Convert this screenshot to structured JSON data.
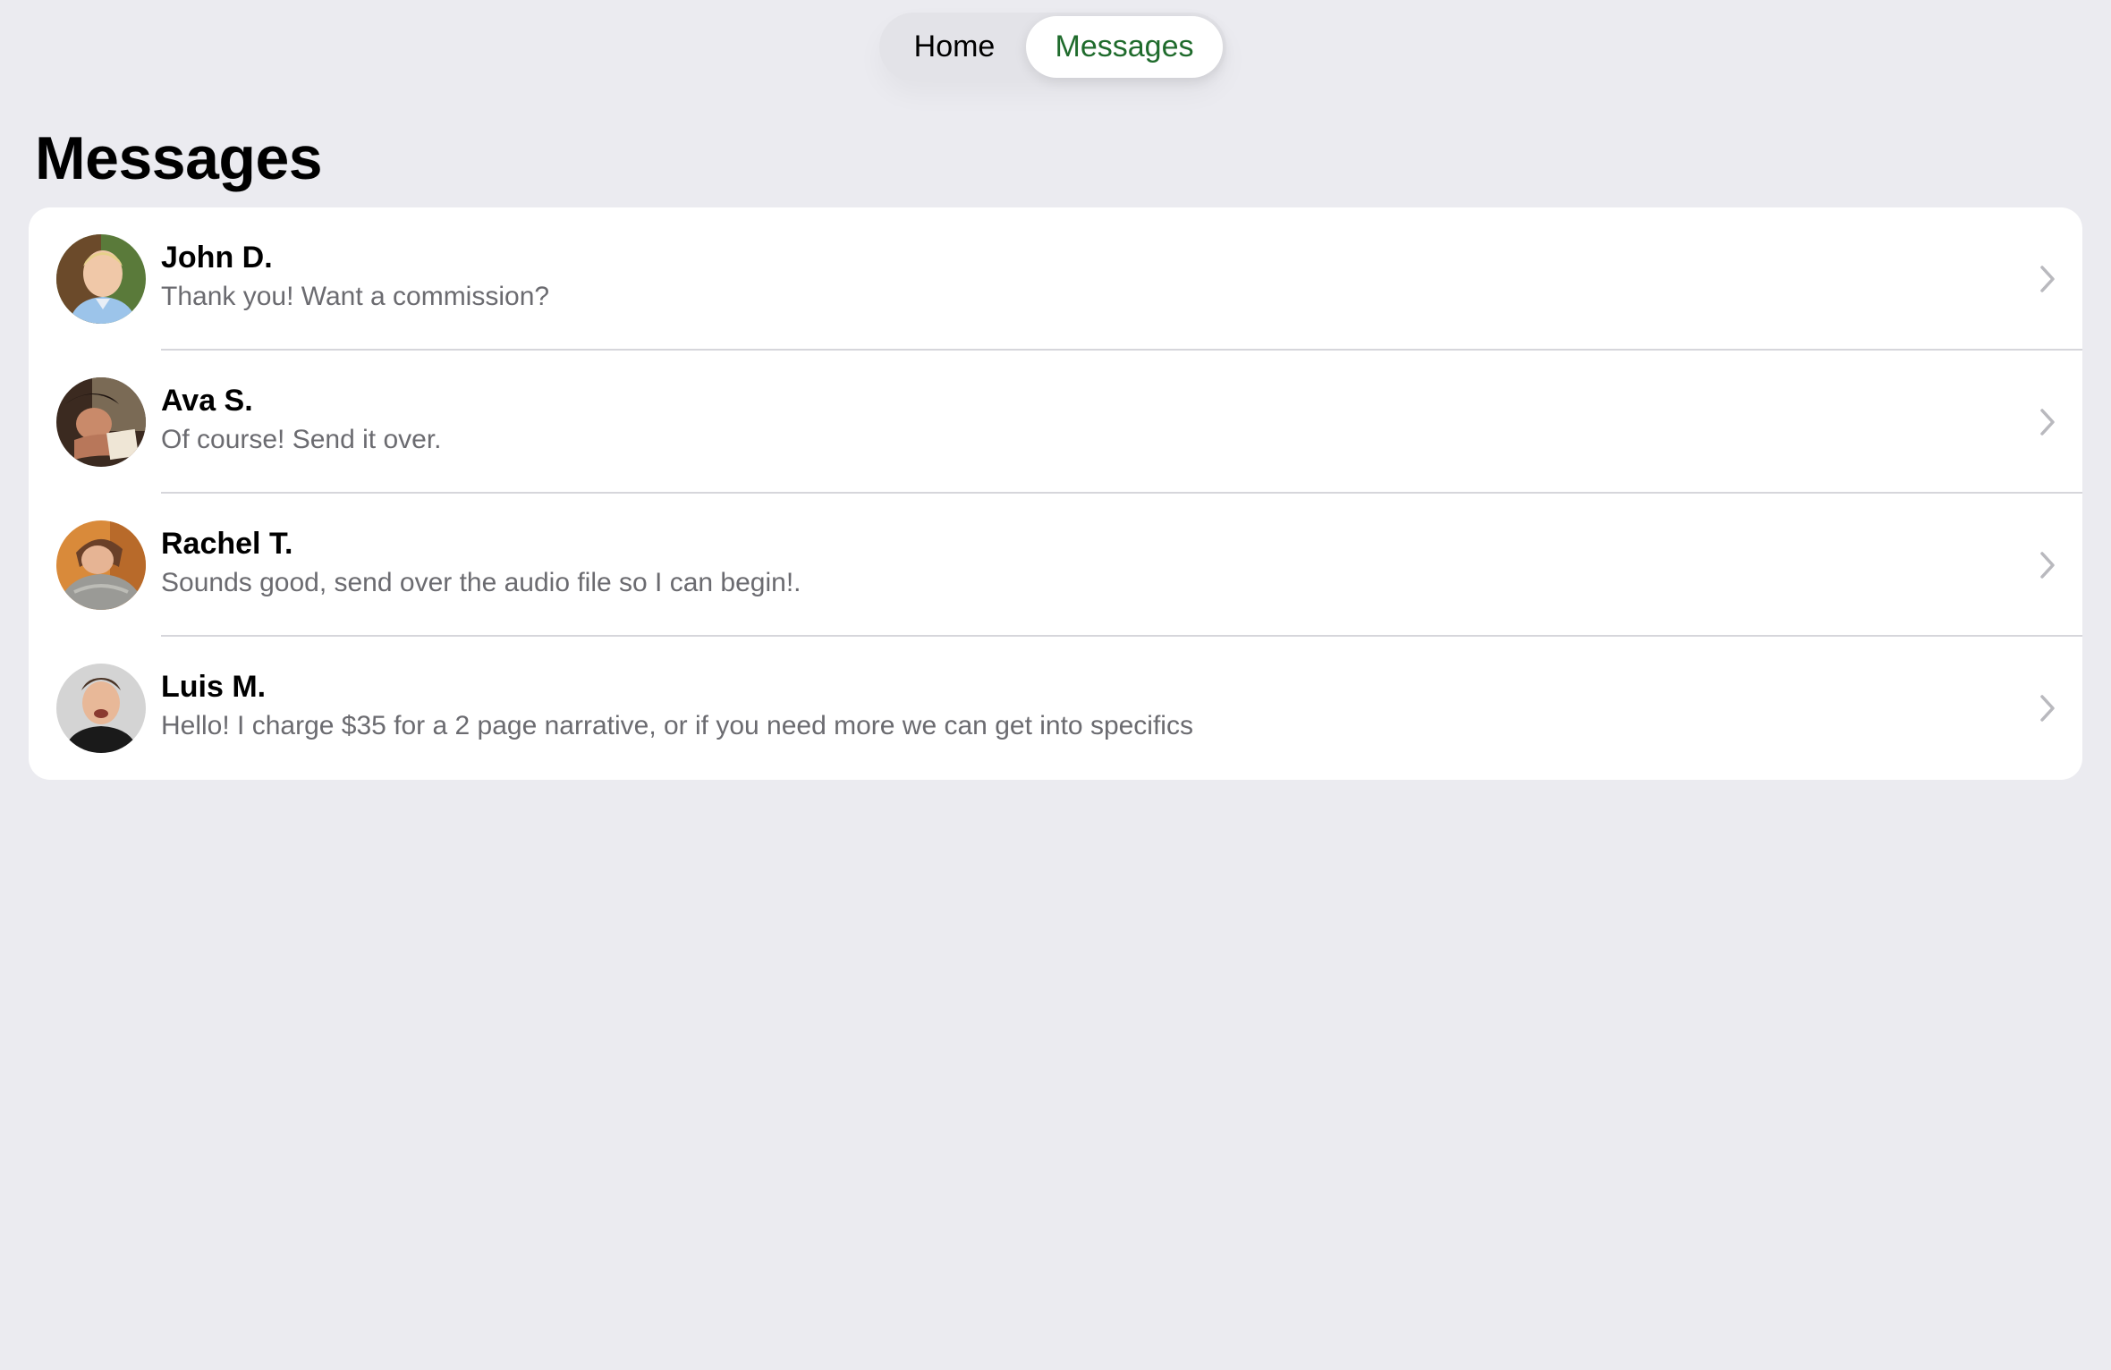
{
  "nav": {
    "tabs": [
      {
        "label": "Home",
        "selected": false
      },
      {
        "label": "Messages",
        "selected": true
      }
    ],
    "accent_color": "#1f6b2c"
  },
  "page": {
    "title": "Messages"
  },
  "conversations": [
    {
      "name": "John D.",
      "preview": "Thank you! Want a commission?",
      "avatar": "photo-avatar"
    },
    {
      "name": "Ava S.",
      "preview": "Of course! Send it over.",
      "avatar": "photo-avatar"
    },
    {
      "name": "Rachel T.",
      "preview": "Sounds good, send over the audio file so I can begin!.",
      "avatar": "photo-avatar"
    },
    {
      "name": "Luis M.",
      "preview": "Hello! I charge $35 for a 2 page narrative, or if you need more we can get into specifics",
      "avatar": "photo-avatar"
    }
  ],
  "icons": {
    "row_disclosure": "chevron-right-icon"
  }
}
